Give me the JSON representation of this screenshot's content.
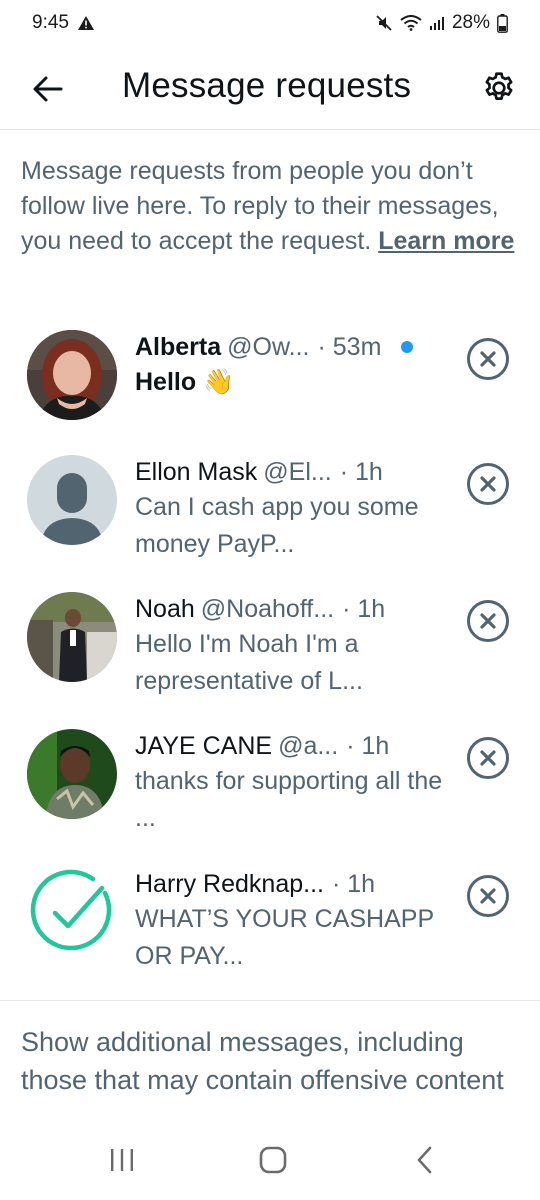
{
  "status_bar": {
    "time": "9:45",
    "alert_icon": "warning-triangle-icon",
    "icons": [
      "mute-icon",
      "wifi-icon",
      "signal-icon"
    ],
    "battery": "28%"
  },
  "header": {
    "title": "Message requests",
    "back_icon": "arrow-left-icon",
    "settings_icon": "gear-icon"
  },
  "intro": {
    "text": "Message requests from people you don’t follow live here. To reply to their messages, you need to accept the request. ",
    "link": "Learn more"
  },
  "requests": [
    {
      "name": "Alberta",
      "handle": "@Ow...",
      "time": "· 53m",
      "message": "Hello 👋",
      "unread": true,
      "avatar": "photo"
    },
    {
      "name": "Ellon Mask",
      "handle": "@El...",
      "time": "· 1h",
      "message": "Can I cash app you some money PayP...",
      "unread": false,
      "avatar": "default-profile"
    },
    {
      "name": "Noah",
      "handle": "@Noahoff...",
      "time": "· 1h",
      "message": "Hello I'm Noah  I'm a representative of L...",
      "unread": false,
      "avatar": "photo"
    },
    {
      "name": "JAYE CANE",
      "handle": "@a...",
      "time": "· 1h",
      "message": "thanks for supporting all the ...",
      "unread": false,
      "avatar": "photo"
    },
    {
      "name": "Harry Redknap...",
      "handle": "",
      "time": "· 1h",
      "message": "WHAT’S YOUR CASHAPP OR PAY...",
      "unread": false,
      "avatar": "green-check"
    }
  ],
  "additional": {
    "text": "Show additional messages, including those that may contain offensive content"
  },
  "nav": {
    "items": [
      "recent-apps-icon",
      "home-icon",
      "back-icon"
    ]
  },
  "colors": {
    "primary_text": "#0f1419",
    "secondary_text": "#536471",
    "unread_dot": "#1d9bf0",
    "check_green": "#1fc79a",
    "divider": "#e6e9ec"
  }
}
